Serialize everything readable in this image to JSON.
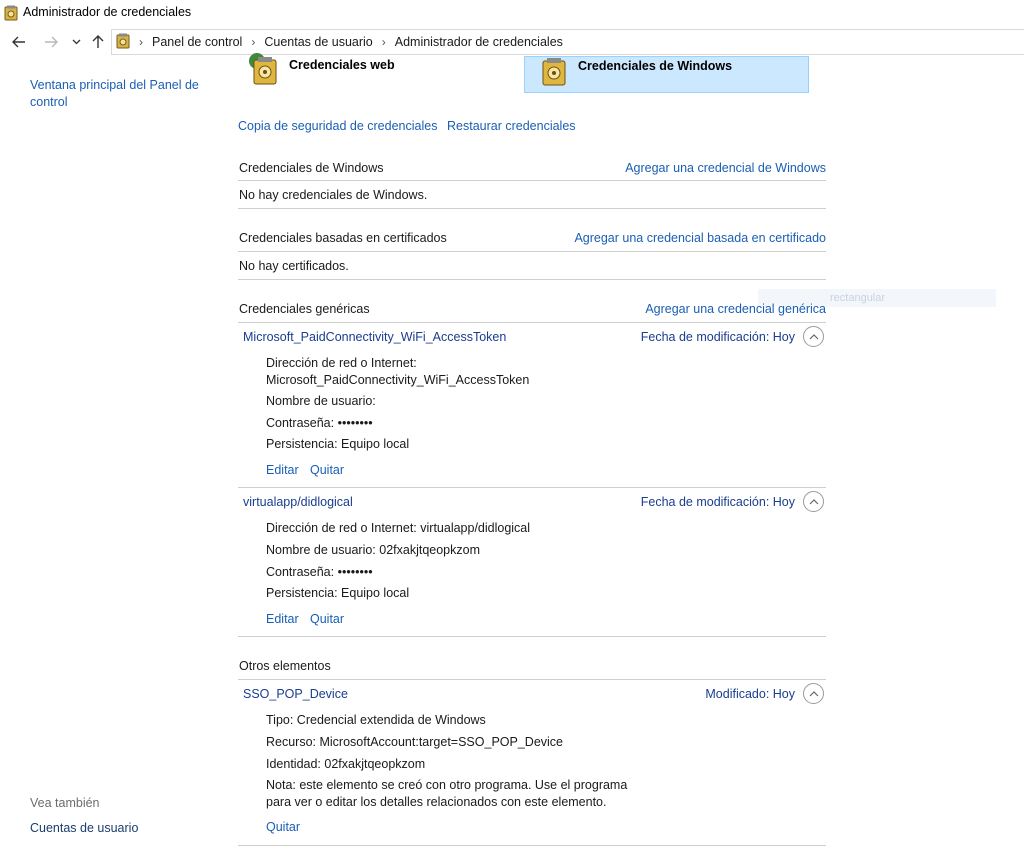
{
  "window": {
    "title": "Administrador de credenciales",
    "icon": "credential-manager-icon"
  },
  "nav": {
    "back": "back-arrow-icon",
    "forward": "forward-arrow-icon",
    "recent": "chevron-down-icon",
    "up": "up-arrow-icon",
    "breadcrumbs": [
      "Panel de control",
      "Cuentas de usuario",
      "Administrador de credenciales"
    ]
  },
  "sidebar": {
    "home_line1": "Ventana principal del Panel de",
    "home_line2": "control",
    "see_also": "Vea también",
    "user_accounts": "Cuentas de usuario"
  },
  "vaults": {
    "web": "Credenciales web",
    "windows": "Credenciales de Windows"
  },
  "actions": {
    "backup": "Copia de seguridad de credenciales",
    "restore": "Restaurar credenciales"
  },
  "windows_creds": {
    "title": "Credenciales de Windows",
    "add": "Agregar una credencial de Windows",
    "empty": "No hay credenciales de Windows."
  },
  "cert_creds": {
    "title": "Credenciales basadas en certificados",
    "add": "Agregar una credencial basada en certificado",
    "empty": "No hay certificados."
  },
  "generic_creds": {
    "title": "Credenciales genéricas",
    "add": "Agregar una credencial genérica",
    "items": [
      {
        "name": "Microsoft_PaidConnectivity_WiFi_AccessToken",
        "meta": "Fecha de modificación:  Hoy",
        "address_label": "Dirección de red o Internet:",
        "address_value": "Microsoft_PaidConnectivity_WiFi_AccessToken",
        "user": "Nombre de usuario:",
        "password": "Contraseña:  ••••••••",
        "persistence": "Persistencia:  Equipo local",
        "edit": "Editar",
        "remove": "Quitar"
      },
      {
        "name": "virtualapp/didlogical",
        "meta": "Fecha de modificación:  Hoy",
        "address": "Dirección de red o Internet:  virtualapp/didlogical",
        "user": "Nombre de usuario:  02fxakjtqeopkzom",
        "password": "Contraseña:  ••••••••",
        "persistence": "Persistencia:  Equipo local",
        "edit": "Editar",
        "remove": "Quitar"
      }
    ]
  },
  "other": {
    "title": "Otros elementos",
    "item": {
      "name": "SSO_POP_Device",
      "meta": "Modificado:  Hoy",
      "type": "Tipo:  Credencial extendida de Windows",
      "resource": "Recurso:  MicrosoftAccount:target=SSO_POP_Device",
      "identity": "Identidad:  02fxakjtqeopkzom",
      "note_line1": "Nota: este elemento se creó con otro programa. Use el programa",
      "note_line2": "para ver o editar los detalles relacionados con este elemento.",
      "remove": "Quitar"
    }
  },
  "ghost_text": "rectangular"
}
